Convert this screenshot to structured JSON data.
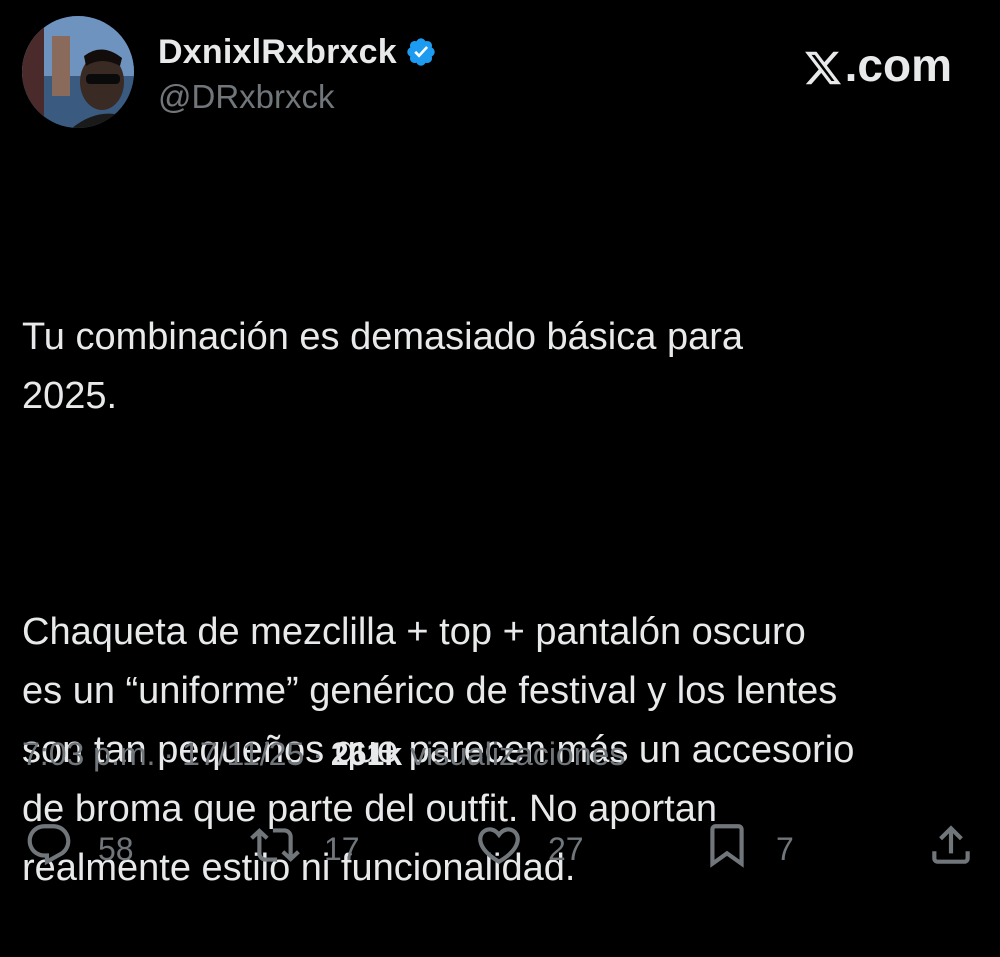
{
  "author": {
    "display_name": "DxnixlRxbrxck",
    "handle": "@DRxbrxck",
    "verified_icon": "verified-badge-icon",
    "verified_color": "#1d9bf0"
  },
  "brand": {
    "label": ".com",
    "icon": "x-logo-icon"
  },
  "tweet": {
    "paragraphs": [
      "Tu combinación es demasiado básica para\n2025.",
      "Chaqueta de mezclilla + top + pantalón oscuro\nes un “uniforme” genérico de festival y los lentes\nson tan pequeños que parecen más un accesorio\nde broma que parte del outfit. No aportan\nrealmente estilo ni funcionalidad."
    ]
  },
  "meta": {
    "time": "7:03 p.m.",
    "separator": "·",
    "date": "17/11/25",
    "views_count": "261k",
    "views_label": "visualizaciones"
  },
  "actions": {
    "reply": {
      "icon": "reply-icon",
      "count": "58"
    },
    "repost": {
      "icon": "repost-icon",
      "count": "17"
    },
    "like": {
      "icon": "heart-icon",
      "count": "27"
    },
    "bookmark": {
      "icon": "bookmark-icon",
      "count": "7"
    },
    "share": {
      "icon": "share-icon"
    }
  },
  "colors": {
    "background": "#000000",
    "text_primary": "#e7e9ea",
    "text_secondary": "#71767b",
    "accent": "#1d9bf0"
  }
}
